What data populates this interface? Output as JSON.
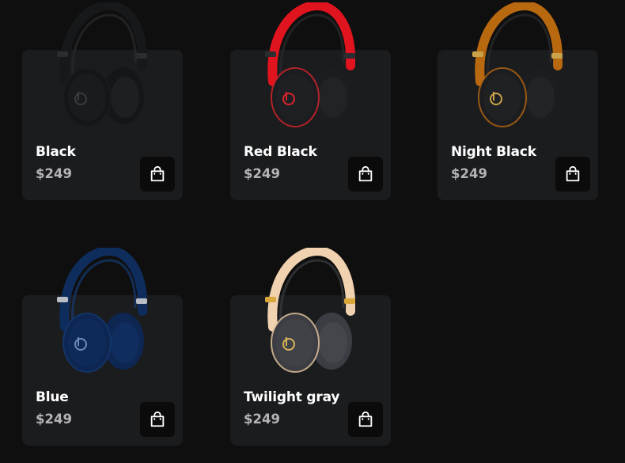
{
  "products": [
    {
      "name": "Black",
      "price": "$249",
      "band": "#17181a",
      "band_hi": "#2a2b2e",
      "cup": "#151618",
      "cushion": "#1e1f22",
      "slider": "#2c2d30",
      "logo": "#3a3b3f",
      "trim": "#1c1d20",
      "icon": "headphones-icon",
      "cart_icon": "shopping-bag-icon"
    },
    {
      "name": "Red Black",
      "price": "$249",
      "band": "#e0141e",
      "band_hi": "#2a2b2e",
      "cup": "#1c1d20",
      "cushion": "#222326",
      "slider": "#2c2d30",
      "logo": "#d8242c",
      "trim": "#d8242c",
      "icon": "headphones-icon",
      "cart_icon": "shopping-bag-icon"
    },
    {
      "name": "Night Black",
      "price": "$249",
      "band": "#b8680f",
      "band_hi": "#2a2b2e",
      "cup": "#1c1d20",
      "cushion": "#232427",
      "slider": "#c9a24a",
      "logo": "#c9a24a",
      "trim": "#b8680f",
      "icon": "headphones-icon",
      "cart_icon": "shopping-bag-icon"
    },
    {
      "name": "Blue",
      "price": "$249",
      "band": "#0e2c5c",
      "band_hi": "#153a72",
      "cup": "#0d2652",
      "cushion": "#0f2d5e",
      "slider": "#b9bec6",
      "logo": "#6f89b3",
      "trim": "#153a72",
      "icon": "headphones-icon",
      "cart_icon": "shopping-bag-icon"
    },
    {
      "name": "Twilight gray",
      "price": "$249",
      "band": "#f0d2b0",
      "band_hi": "#3a3c40",
      "cup": "#3b3d42",
      "cushion": "#44464b",
      "slider": "#d9a73a",
      "logo": "#d9b35a",
      "trim": "#e8c9a0",
      "icon": "headphones-icon",
      "cart_icon": "shopping-bag-icon"
    }
  ]
}
